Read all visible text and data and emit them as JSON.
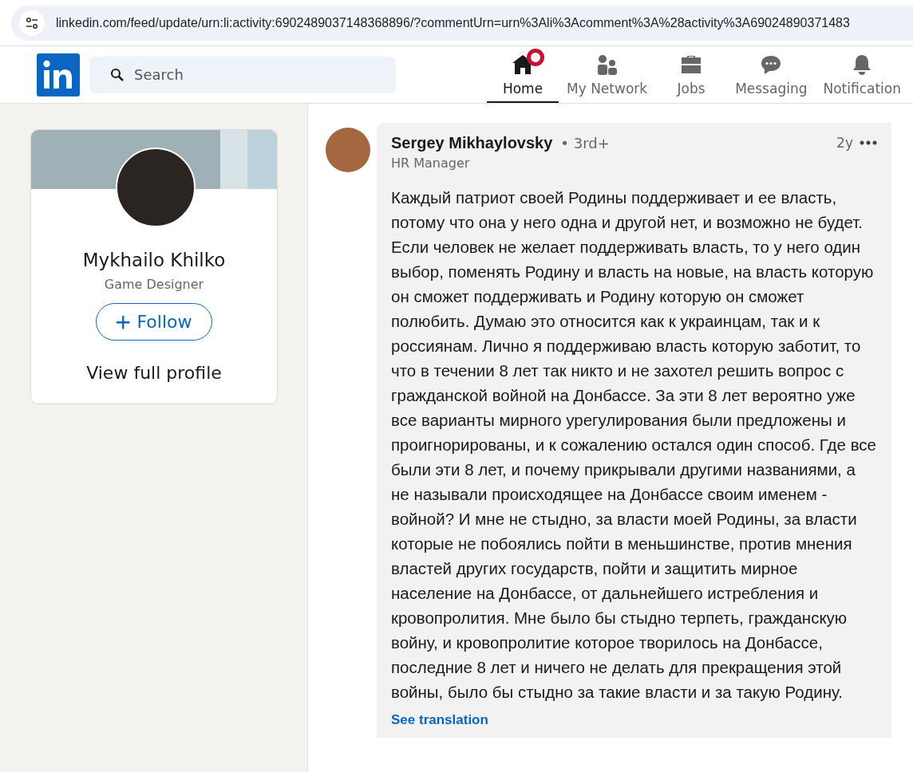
{
  "browser": {
    "url": "linkedin.com/feed/update/urn:li:activity:6902489037148368896/?commentUrn=urn%3Ali%3Acomment%3A%28activity%3A69024890371483"
  },
  "header": {
    "search": {
      "placeholder": "Search"
    },
    "nav": [
      {
        "label": "Home",
        "kind": "home",
        "selected": true,
        "badge": true
      },
      {
        "label": "My Network",
        "kind": "network",
        "selected": false,
        "badge": false
      },
      {
        "label": "Jobs",
        "kind": "jobs",
        "selected": false,
        "badge": false
      },
      {
        "label": "Messaging",
        "kind": "messaging",
        "selected": false,
        "badge": false
      },
      {
        "label": "Notification",
        "kind": "bell",
        "selected": false,
        "badge": false
      }
    ]
  },
  "profile_card": {
    "name": "Mykhailo Khilko",
    "headline": "Game Designer",
    "follow_button": "Follow",
    "view_profile": "View full profile"
  },
  "comment": {
    "author": "Sergey Mikhaylovsky",
    "degree": "• 3rd+",
    "headline": "HR Manager",
    "time": "2y",
    "text": "Каждый патриот своей Родины поддерживает и ее власть, потому что она у него одна и другой нет, и возможно не будет. Если человек не желает поддерживать власть, то у него один выбор, поменять Родину и власть на новые, на власть которую он сможет поддерживать и Родину которую он сможет полюбить. Думаю это относится как к украинцам, так и к россиянам. Лично я поддерживаю власть которую заботит, то что в течении 8 лет так никто и не захотел решить вопрос с гражданской войной на Донбассе. За эти 8 лет вероятно уже все варианты мирного урегулирования были предложены и проигнорированы, и к сожалению остался один способ. Где все были эти 8 лет, и почему прикрывали другими названиями, а не называли происходящее на Донбассе своим именем - войной? И мне не стыдно, за власти моей Родины, за власти которые не побоялись пойти в меньшинстве, против мнения властей других государств, пойти и защитить мирное население на Донбассе, от дальнейшего истребления и кровопролития. Мне было бы стыдно терпеть, гражданскую войну, и кровопролитие которое творилось на Донбассе, последние 8 лет и ничего не делать для прекращения этой войны, было бы стыдно за такие власти и за такую Родину.",
    "translation_link": "See translation"
  }
}
